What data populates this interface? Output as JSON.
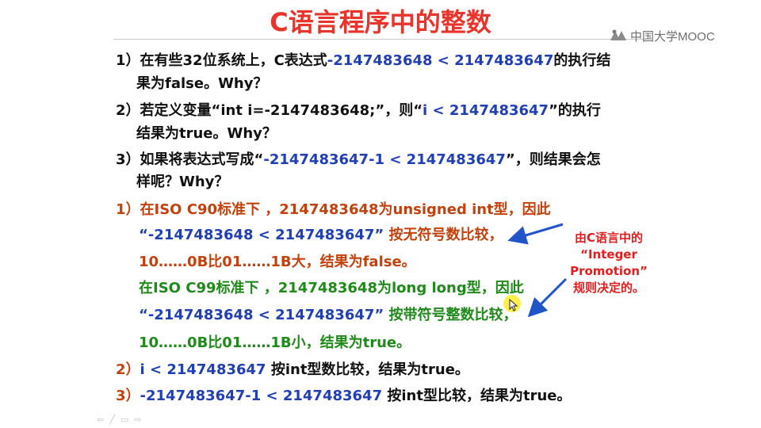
{
  "title": "C语言程序中的整数",
  "logo": {
    "text": "中国大学MOOC"
  },
  "lines": [
    {
      "p1": "1）在有些32位系统上，C表达式",
      "p2": "-2147483648 < 2147483647",
      "p3": "的执行结"
    },
    {
      "p1": "果为false。Why？"
    },
    {
      "p1": "2）若定义变量“int i=-2147483648;”，则“",
      "p2": "i < 2147483647",
      "p3": "”的执行"
    },
    {
      "p1": "结果为true。Why？"
    },
    {
      "p1": "3）如果将表达式写成“",
      "p2": "-2147483647-1 < 2147483647",
      "p3": "”，则结果会怎"
    },
    {
      "p1": "样呢？Why？"
    },
    {
      "p1": "1）在ISO C90标准下 ，2147483648为unsigned int型，因此"
    },
    {
      "p1": "“-2147483648 < 2147483647”",
      "p2": " 按无符号数比较，"
    },
    {
      "p1": "10……0B比01……1B大，结果为false。"
    },
    {
      "p1": "在ISO C99标准下 ，2147483648为long long型，因此"
    },
    {
      "p1": "“-2147483648 < 2147483647”",
      "p2": " 按带符号整数比较，"
    },
    {
      "p1": "10……0B比01……1B小，结果为true。"
    },
    {
      "p1": "2）",
      "p2": "i < 2147483647",
      "p3": " 按int型数比较，结果为true。"
    },
    {
      "p1": "3）",
      "p2": "-2147483647-1 < 2147483647",
      "p3": " 按int型比较，结果为true。"
    }
  ],
  "note": [
    "由C语言中的",
    "“Integer",
    "Promotion”",
    "规则决定的。"
  ],
  "slide_controls": [
    "⇦",
    "╱",
    "▭",
    "⇨"
  ],
  "colors": {
    "title": "#e8352c",
    "blue": "#1f3fb3",
    "red": "#c2410c",
    "green": "#1f8a1a",
    "note": "#e31d1d",
    "arrow": "#1f55c9"
  }
}
